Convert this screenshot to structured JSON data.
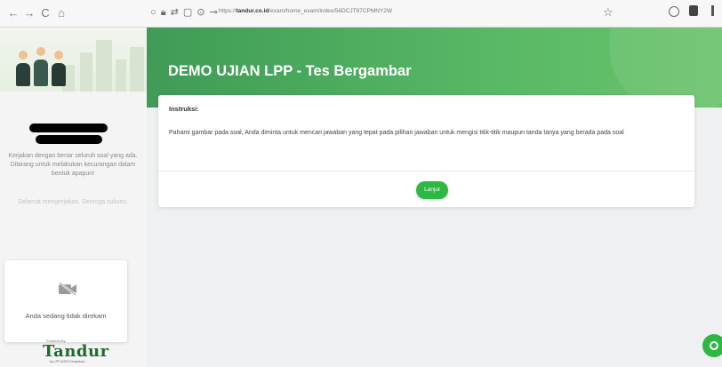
{
  "browser": {
    "url_prefix": "https://",
    "url_domain": "tandur.co.id",
    "url_path": "/exam/home_exam/index/56DCJT87CPMNY2W",
    "nav_back": "←",
    "nav_forward": "→",
    "nav_reload": "C",
    "nav_home": "⌂",
    "star": "☆"
  },
  "sidebar": {
    "message": "Kerjakan dengan benar seluruh soal yang ada. Dilarang untuk melakukan kecurangan dalam bentuk apapun!",
    "wish": "Selamat mengerjakan. Semoga sukses.",
    "camera_status": "Anda sedang tidak direkam",
    "powered_by": "Powered By",
    "logo_text": "Tandur",
    "logo_sub": "by LPP AGRO Nusantara"
  },
  "header": {
    "title": "DEMO UJIAN LPP - Tes Bergambar"
  },
  "card": {
    "instruction_heading": "Instruksi:",
    "instruction_body": "Pahami gambar pada soal, Anda diminta untuk mencari jawaban yang tepat pada pilihan jawaban untuk mengisi titik-titik maupun tanda tanya yang berada pada soal",
    "next_button": "Lanjut"
  },
  "colors": {
    "brand_green": "#2db843",
    "header_green": "#4caf5a"
  }
}
